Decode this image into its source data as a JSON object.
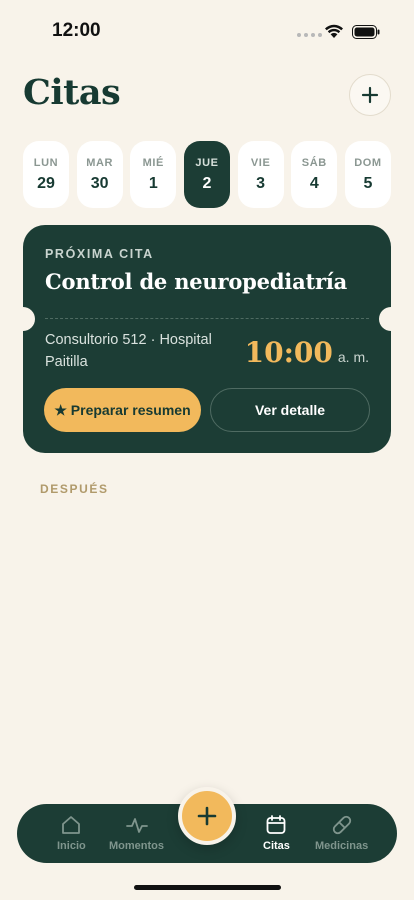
{
  "status_bar": {
    "time": "12:00"
  },
  "header": {
    "title": "Citas",
    "add_icon": "plus-icon"
  },
  "week": [
    {
      "dow": "LUN",
      "day": "29",
      "active": false
    },
    {
      "dow": "MAR",
      "day": "30",
      "active": false
    },
    {
      "dow": "MIÉ",
      "day": "1",
      "active": false
    },
    {
      "dow": "JUE",
      "day": "2",
      "active": true
    },
    {
      "dow": "VIE",
      "day": "3",
      "active": false
    },
    {
      "dow": "SÁB",
      "day": "4",
      "active": false
    },
    {
      "dow": "DOM",
      "day": "5",
      "active": false
    }
  ],
  "next_appointment": {
    "kicker": "PRÓXIMA CITA",
    "title": "Control de neuropediatría",
    "location": "Consultorio 512 · Hospital Paitilla",
    "time": "10:00",
    "ampm": "a. m.",
    "primary_label": "★ Preparar resumen",
    "secondary_label": "Ver detalle"
  },
  "section_later": "DESPUÉS",
  "tabs": [
    {
      "label": "Inicio",
      "icon": "home-icon",
      "active": false
    },
    {
      "label": "Momentos",
      "icon": "activity-icon",
      "active": false
    },
    {
      "label": "Citas",
      "icon": "calendar-icon",
      "active": true
    },
    {
      "label": "Medicinas",
      "icon": "pill-icon",
      "active": false
    }
  ],
  "colors": {
    "background": "#f8f3ea",
    "primary_dark": "#1c3d35",
    "accent": "#f2b95c",
    "muted_label": "#b09a6b"
  }
}
